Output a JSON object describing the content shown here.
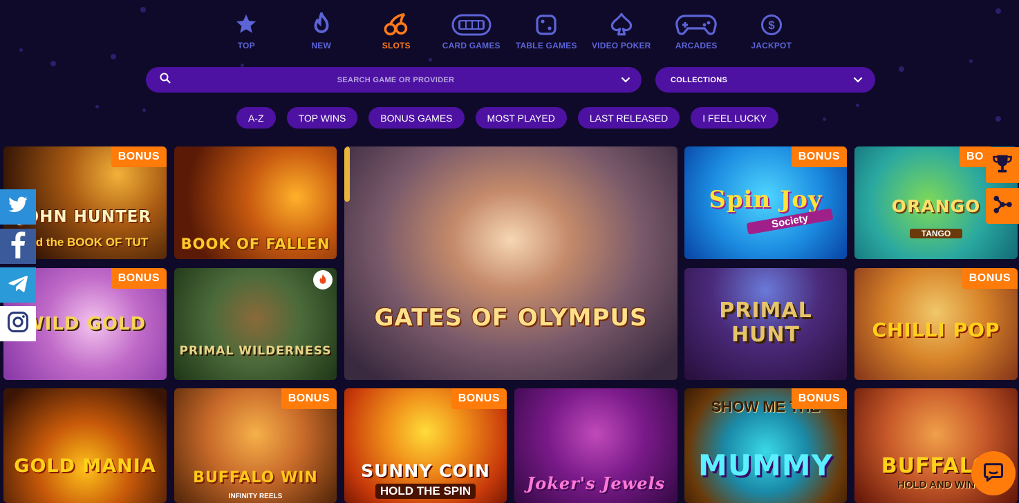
{
  "nav": {
    "categories": [
      {
        "label": "TOP",
        "icon": "star-icon"
      },
      {
        "label": "NEW",
        "icon": "flame-icon"
      },
      {
        "label": "SLOTS",
        "icon": "cherries-icon"
      },
      {
        "label": "CARD GAMES",
        "icon": "card-table-icon"
      },
      {
        "label": "TABLE GAMES",
        "icon": "dice-icon"
      },
      {
        "label": "VIDEO POKER",
        "icon": "spade-icon"
      },
      {
        "label": "ARCADES",
        "icon": "gamepad-icon"
      },
      {
        "label": "JACKPOT",
        "icon": "dollar-coin-icon"
      }
    ],
    "active": "SLOTS"
  },
  "search": {
    "placeholder": "SEARCH GAME OR PROVIDER"
  },
  "collections": {
    "label": "COLLECTIONS"
  },
  "filters": [
    "A-Z",
    "TOP WINS",
    "BONUS GAMES",
    "MOST PLAYED",
    "LAST RELEASED",
    "I FEEL LUCKY"
  ],
  "games": [
    {
      "title": "JOHN HUNTER",
      "subtitle": "and the BOOK OF TUT",
      "badge": "BONUS"
    },
    {
      "title": "BOOK OF FALLEN",
      "badge": ""
    },
    {
      "title": "GATES OF OLYMPUS",
      "badge": ""
    },
    {
      "title": "Spin Joy",
      "subtitle": "Society",
      "badge": "BONUS"
    },
    {
      "title": "ORANGO",
      "subtitle": "TANGO",
      "badge": "BO"
    },
    {
      "title": "WILD GOLD",
      "badge": "BONUS"
    },
    {
      "title": "PRIMAL WILDERNESS",
      "badge": ""
    },
    {
      "title": "PRIMAL HUNT",
      "badge": ""
    },
    {
      "title": "CHILLI POP",
      "badge": "BONUS"
    },
    {
      "title": "GOLD MANIA",
      "badge": ""
    },
    {
      "title": "BUFFALO WIN",
      "subtitle": "INFINITY REELS",
      "badge": "BONUS"
    },
    {
      "title": "SUNNY COIN",
      "subtitle": "HOLD THE SPIN",
      "badge": "BONUS"
    },
    {
      "title": "Joker's Jewels",
      "badge": ""
    },
    {
      "title": "MUMMY",
      "subtitle": "SHOW ME THE",
      "badge": "BONUS"
    },
    {
      "title": "BUFFALO",
      "subtitle": "HOLD AND WIN",
      "badge": ""
    }
  ],
  "social": [
    "twitter-icon",
    "facebook-icon",
    "telegram-icon",
    "instagram-icon"
  ],
  "colors": {
    "background": "#0f0a2a",
    "pill": "#4e12a3",
    "accent": "#ff7b0a",
    "nav_label": "#5c64d6"
  }
}
